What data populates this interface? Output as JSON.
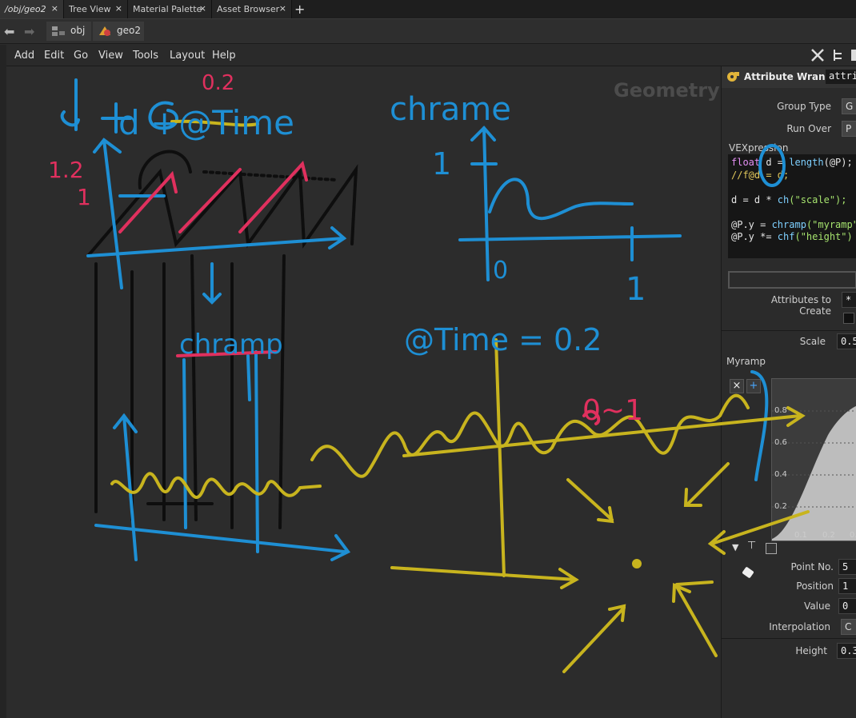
{
  "tabs": [
    {
      "label": "/obj/geo2",
      "active": true
    },
    {
      "label": "Tree View"
    },
    {
      "label": "Material Palette"
    },
    {
      "label": "Asset Browser"
    }
  ],
  "tab_close": "×",
  "tab_add": "+",
  "path": {
    "crumb1": "obj",
    "crumb2": "geo2"
  },
  "menu": [
    "Add",
    "Edit",
    "Go",
    "View",
    "Tools",
    "Layout",
    "Help"
  ],
  "viewport": {
    "label": "Geometry"
  },
  "node": {
    "type_label": "Attribute Wrangle",
    "name_value": "attri"
  },
  "params": {
    "group_type_label": "Group Type",
    "group_type_value": "G",
    "run_over_label": "Run Over",
    "run_over_value": "P",
    "vex_label": "VEXpression",
    "code": [
      {
        "a": "float",
        "b": " d = ",
        "c": "length",
        "d": "(@P);"
      },
      {
        "comment": "//f@d = d;"
      },
      {
        "plain": ""
      },
      {
        "plain": "d = d * ",
        "fn": "ch",
        "s": "(\"scale\");"
      },
      {
        "plain": ""
      },
      {
        "plain": "@P.y = ",
        "fn": "chramp",
        "s": "(\"myramp\""
      },
      {
        "plain": "@P.y *= ",
        "fn": "chf",
        "s": "(\"height\")"
      }
    ],
    "attrs_label": "Attributes to Create",
    "attrs_value": "*",
    "scale_label": "Scale",
    "scale_value": "0.5",
    "ramp_label": "Myramp",
    "ramp_remove": "×",
    "ramp_add": "+",
    "ramp_x_ticks": [
      "0.1",
      "0.2",
      "0."
    ],
    "ramp_y_ticks": [
      "0.8",
      "0.6",
      "0.4",
      "0.2"
    ],
    "point_no_label": "Point No.",
    "point_no_value": "5",
    "position_label": "Position",
    "position_value": "1",
    "value_label": "Value",
    "value_value": "0",
    "interp_label": "Interpolation",
    "interp_value": "C",
    "height_label": "Height",
    "height_value": "0.3"
  },
  "annotations": {
    "formula": "d +@Time",
    "time_value": "0.2",
    "chramp_title": "chrame",
    "chramp_label": "chramp",
    "time_eq": "@Time = 0.2",
    "range": "0~1",
    "y_1_2": "1.2",
    "y_1": "1",
    "graph_1": "1",
    "graph_0": "0",
    "graph_x1": "1"
  },
  "colors": {
    "blue": "#1e8fd4",
    "yellow": "#c8b41e",
    "pink": "#e0305e",
    "black": "#0e0e0e"
  }
}
